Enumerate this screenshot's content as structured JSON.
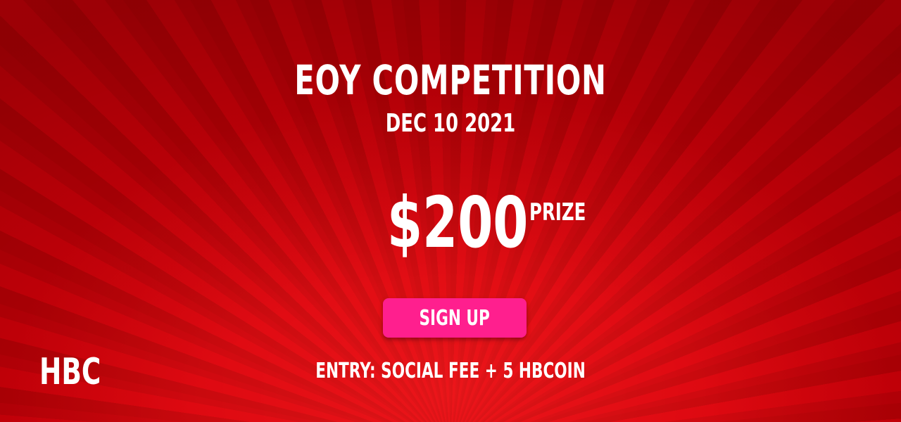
{
  "event": {
    "title": "EOY COMPETITION",
    "date": "DEC 10 2021"
  },
  "prize": {
    "amount": "$200",
    "label": "PRIZE"
  },
  "signup": {
    "label": "SIGN UP"
  },
  "entry": {
    "text": "ENTRY: SOCIAL FEE + 5 HBCOIN"
  },
  "brand": {
    "logo_text": "HBC"
  },
  "colors": {
    "background": "#c30008",
    "button": "#ff1f8e",
    "text": "#ffffff"
  }
}
